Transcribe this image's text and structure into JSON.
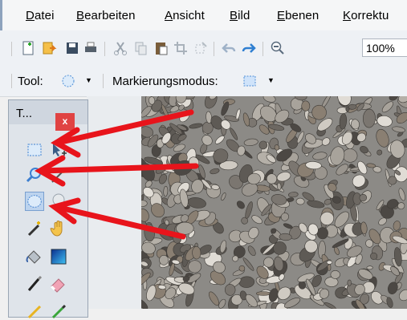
{
  "menu": {
    "items": [
      {
        "label": "Datei"
      },
      {
        "label": "Bearbeiten"
      },
      {
        "label": "Ansicht"
      },
      {
        "label": "Bild"
      },
      {
        "label": "Ebenen"
      },
      {
        "label": "Korrektu"
      }
    ]
  },
  "toolbar": {
    "icons": [
      "new-file-icon",
      "open-file-icon",
      "save-icon",
      "print-icon",
      "cut-icon",
      "copy-icon",
      "paste-icon",
      "crop-icon",
      "deselect-icon",
      "undo-icon",
      "redo-icon",
      "zoom-out-icon"
    ],
    "zoom_value": "100%"
  },
  "options": {
    "tool_label": "Tool:",
    "selection_mode_label": "Markierungsmodus:"
  },
  "tools_panel": {
    "title": "T...",
    "close_label": "x",
    "selected_tool": "ellipse-select-icon",
    "tools": [
      "rectangle-select-icon",
      "move-selection-icon",
      "zoom-icon",
      "magic-wand-icon",
      "ellipse-select-icon",
      "lasso-select-icon",
      "magic-wand-icon",
      "pan-icon",
      "paint-bucket-icon",
      "gradient-icon",
      "paintbrush-icon",
      "eraser-icon",
      "pencil-icon",
      "color-picker-icon"
    ]
  },
  "colors": {
    "annotation_arrow": "#e8141b",
    "close_button": "#e04343",
    "selection_highlight": "#bcd3ee"
  }
}
